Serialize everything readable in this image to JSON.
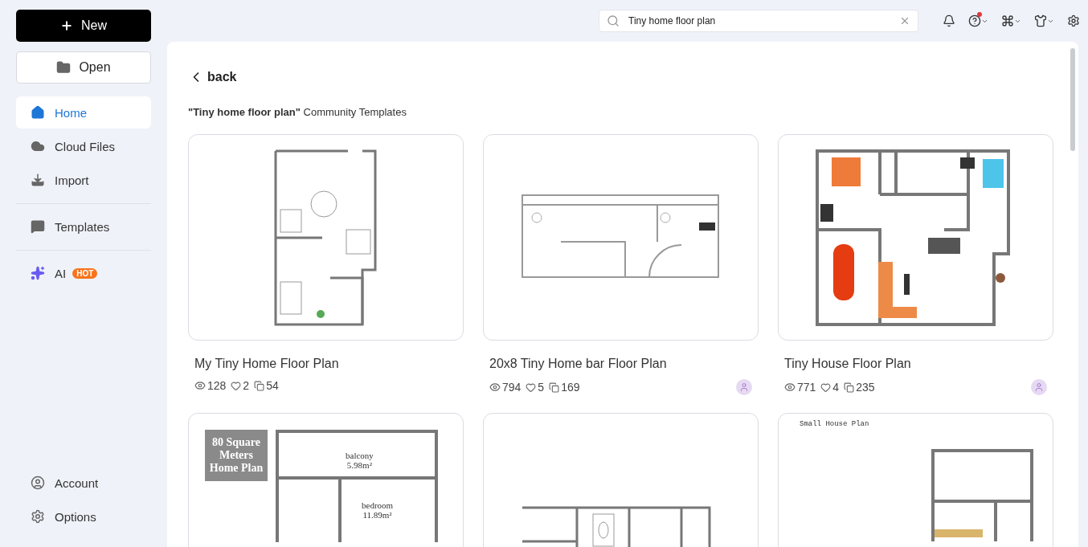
{
  "sidebar": {
    "new_button": "New",
    "open_button": "Open",
    "items": [
      {
        "label": "Home",
        "selected": true
      },
      {
        "label": "Cloud Files",
        "selected": false
      },
      {
        "label": "Import",
        "selected": false,
        "divider_after": true
      },
      {
        "label": "Templates",
        "selected": false,
        "divider_after": true
      },
      {
        "label": "AI",
        "selected": false,
        "badge": "HOT"
      }
    ],
    "bottom_items": [
      {
        "label": "Account"
      },
      {
        "label": "Options"
      }
    ]
  },
  "search": {
    "value": "Tiny home floor plan"
  },
  "toolbar": {
    "help_notification": true
  },
  "back": "back",
  "heading": "**\"Tiny home floor plan\"** Community Templates",
  "cards": [
    {
      "thumbnail": {
        "kind": "tall"
      },
      "title": "My Tiny Home Floor Plan",
      "views": "128",
      "likes": "2",
      "copies": "54",
      "avatar": false
    },
    {
      "thumbnail": {
        "kind": "wide"
      },
      "title": "20x8 Tiny Home bar Floor Plan",
      "views": "794",
      "likes": "5",
      "copies": "169",
      "avatar": true
    },
    {
      "thumbnail": {
        "kind": "colored"
      },
      "title": "Tiny House Floor Plan",
      "views": "771",
      "likes": "4",
      "copies": "235",
      "avatar": true
    },
    {
      "thumbnail": {
        "kind": "boxed",
        "caption": "80 Square Meters Home Plan",
        "rooms": [
          {
            "name": "balcony",
            "area": "5.98m²"
          },
          {
            "name": "bedroom",
            "area": "11.89m²"
          }
        ]
      }
    },
    {
      "thumbnail": {
        "kind": "grid"
      }
    },
    {
      "thumbnail": {
        "kind": "captioned",
        "caption": "Small House Plan"
      }
    }
  ]
}
